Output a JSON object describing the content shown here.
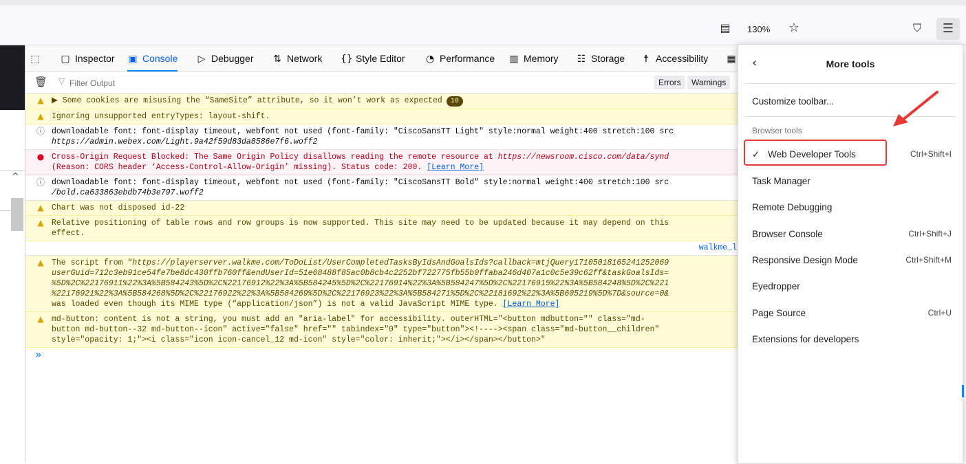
{
  "browser": {
    "zoom": "130%",
    "icons": [
      "reader-view-icon",
      "bookmark-star-icon",
      "pocket-icon",
      "hamburger-menu-icon"
    ]
  },
  "devtools": {
    "tabs": [
      {
        "label": "Inspector",
        "icon": "inspector-icon"
      },
      {
        "label": "Console",
        "icon": "console-icon",
        "active": true
      },
      {
        "label": "Debugger",
        "icon": "debugger-icon"
      },
      {
        "label": "Network",
        "icon": "network-icon"
      },
      {
        "label": "Style Editor",
        "icon": "style-editor-icon"
      },
      {
        "label": "Performance",
        "icon": "performance-icon"
      },
      {
        "label": "Memory",
        "icon": "memory-icon"
      },
      {
        "label": "Storage",
        "icon": "storage-icon"
      },
      {
        "label": "Accessibility",
        "icon": "accessibility-icon"
      }
    ],
    "filter_placeholder": "Filter Output",
    "filter_buttons": [
      "Errors",
      "Warnings"
    ],
    "messages": [
      {
        "type": "warn",
        "text": "▶ Some cookies are misusing the “SameSite” attribute, so it won’t work as expected",
        "badge": "10"
      },
      {
        "type": "warn",
        "text": "Ignoring unsupported entryTypes: layout-shift."
      },
      {
        "type": "info",
        "line1": "downloadable font: font-display timeout, webfont not used (font-family: \"CiscoSansTT Light\" style:normal weight:400 stretch:100 src",
        "line2": "https://admin.webex.com/Light.9a42f59d83da8586e7f6.woff2"
      },
      {
        "type": "error",
        "line1a": "Cross-Origin Request Blocked: The Same Origin Policy disallows reading the remote resource at ",
        "line1b": "https://newsroom.cisco.com/data/synd",
        "line2": "(Reason: CORS header ‘Access-Control-Allow-Origin’ missing). Status code: 200.",
        "link": "[Learn More]"
      },
      {
        "type": "info",
        "line1": "downloadable font: font-display timeout, webfont not used (font-family: \"CiscoSansTT Bold\" style:normal weight:400 stretch:100 src",
        "line2": "/bold.ca633863ebdb74b3e797.woff2"
      },
      {
        "type": "warn",
        "text": "Chart was not disposed id-22"
      },
      {
        "type": "warn",
        "line1": "Relative positioning of table rows and row groups is now supported. This site may need to be updated because it may depend on this",
        "line2": "effect."
      },
      {
        "type": "source",
        "text": "walkme_l"
      },
      {
        "type": "warn",
        "line1a": "The script from “",
        "line1b": "https://playerserver.walkme.com/ToDoList/UserCompletedTasksByIdsAndGoalsIds?callback=mtjQuery17105018165241252069",
        "line2": "userGuid=712c3eb91ce54fe7be8dc430ffb760ff&endUserId=51e68488f85ac0b8cb4c2252bf722775fb55b0ffaba246d407a1c0c5e39c62ff&taskGoalsIds=",
        "line3": "%5D%2C%22176911%22%3A%5B584243%5D%2C%22176912%22%3A%5B584245%5D%2C%22176914%22%3A%5B584247%5D%2C%22176915%22%3A%5B584248%5D%2C%221",
        "line4": "%22176921%22%3A%5B584268%5D%2C%22176922%22%3A%5B584269%5D%2C%22176923%22%3A%5B584271%5D%2C%22181692%22%3A%5B605219%5D%7D&source=0&",
        "line5": "was loaded even though its MIME type (“application/json”) is not a valid JavaScript MIME type.",
        "link": "[Learn More]"
      },
      {
        "type": "warn",
        "line1": "md-button: content is not a string, you must add an \"aria-label\" for accessibility.  outerHTML=\"<button mdbutton=\"\" class=\"md-",
        "line2": "button md-button--32 md-button--icon\" active=\"false\" href=\"\" tabindex=\"0\" type=\"button\"><!----><span class=\"md-button__children\"",
        "line3": "style=\"opacity: 1;\"><i class=\"icon icon-cancel_12 md-icon\" style=\"color: inherit;\"></i></span></button>\""
      }
    ],
    "prompt_symbol": "»"
  },
  "menu": {
    "back_symbol": "‹",
    "title": "More tools",
    "items": [
      {
        "label": "Customize toolbar..."
      },
      {
        "section": "Browser tools"
      },
      {
        "label": "Web Developer Tools",
        "shortcut": "Ctrl+Shift+I",
        "checked": true,
        "highlighted": true
      },
      {
        "label": "Task Manager"
      },
      {
        "label": "Remote Debugging"
      },
      {
        "label": "Browser Console",
        "shortcut": "Ctrl+Shift+J"
      },
      {
        "label": "Responsive Design Mode",
        "shortcut": "Ctrl+Shift+M"
      },
      {
        "label": "Eyedropper"
      },
      {
        "label": "Page Source",
        "shortcut": "Ctrl+U"
      },
      {
        "label": "Extensions for developers"
      }
    ],
    "highlight_color": "#e53935"
  }
}
